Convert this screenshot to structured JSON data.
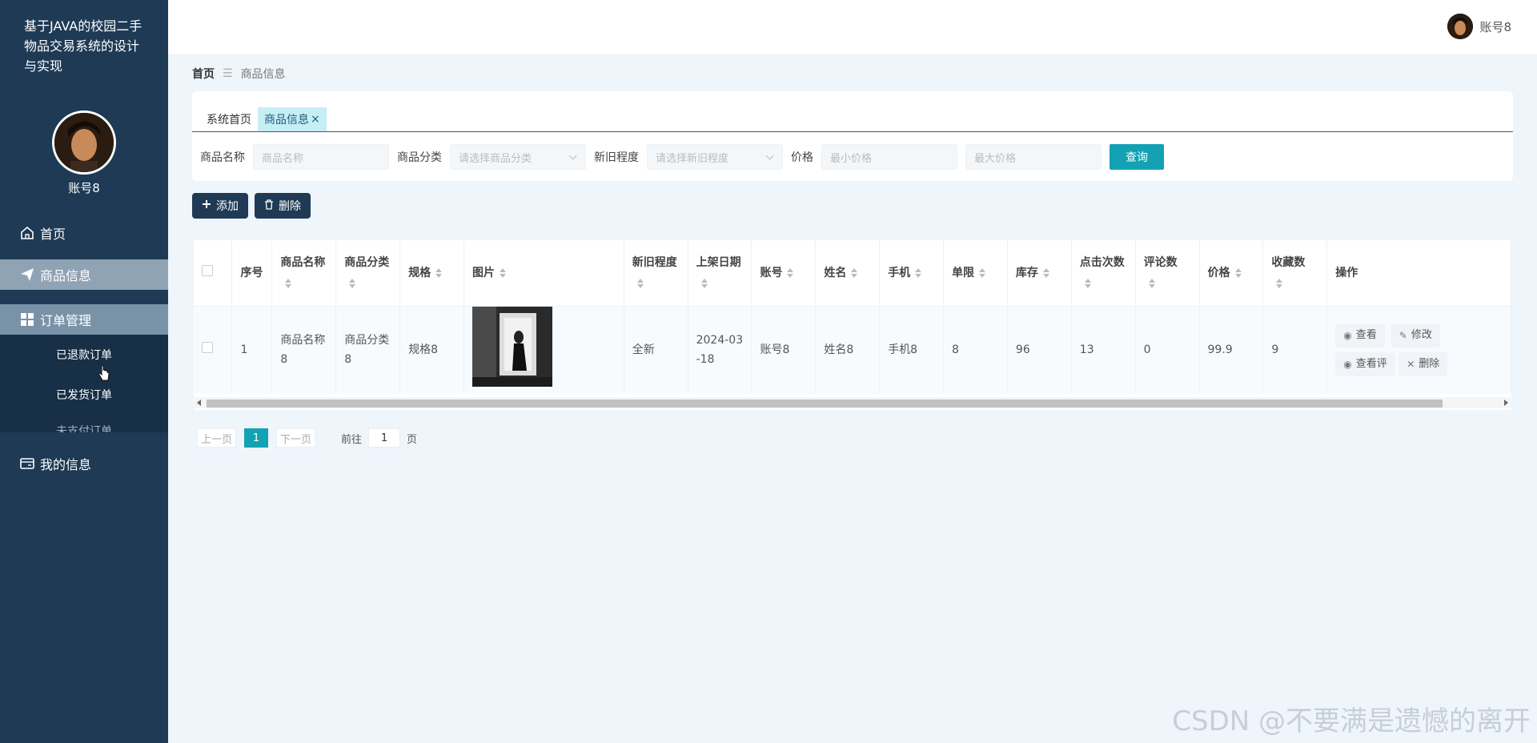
{
  "sidebar": {
    "title": "基于JAVA的校园二手物品交易系统的设计与实现",
    "username": "账号8",
    "menu": {
      "home": "首页",
      "product_info": "商品信息",
      "order_mgmt": "订单管理",
      "sub_refunded": "已退款订单",
      "sub_shipped": "已发货订单",
      "sub_cut": "未支付订单",
      "my_info": "我的信息"
    }
  },
  "header": {
    "username": "账号8"
  },
  "breadcrumb": {
    "home": "首页",
    "separator": "☰",
    "current": "商品信息"
  },
  "tabs": [
    {
      "label": "系统首页"
    },
    {
      "label": "商品信息",
      "close": "×"
    }
  ],
  "search": {
    "name_label": "商品名称",
    "name_placeholder": "商品名称",
    "category_label": "商品分类",
    "category_placeholder": "请选择商品分类",
    "condition_label": "新旧程度",
    "condition_placeholder": "请选择新旧程度",
    "price_label": "价格",
    "price_min_placeholder": "最小价格",
    "price_max_placeholder": "最大价格",
    "query_button": "查询"
  },
  "toolbar": {
    "add_label": "添加",
    "delete_label": "删除"
  },
  "table": {
    "headers": {
      "index": "序号",
      "name": "商品名称",
      "category": "商品分类",
      "spec": "规格",
      "image": "图片",
      "condition": "新旧程度",
      "date": "上架日期",
      "account": "账号",
      "realname": "姓名",
      "phone": "手机",
      "limit": "单限",
      "stock": "库存",
      "clicks": "点击次数",
      "comments": "评论数",
      "price": "价格",
      "favorites": "收藏数",
      "ops": "操作"
    },
    "rows": [
      {
        "index": "1",
        "name": "商品名称8",
        "category": "商品分类8",
        "spec": "规格8",
        "condition": "全新",
        "date": "2024-03-18",
        "account": "账号8",
        "realname": "姓名8",
        "phone": "手机8",
        "limit": "8",
        "stock": "96",
        "clicks": "13",
        "comments": "0",
        "price": "99.9",
        "favorites": "9",
        "op_view": "查看",
        "op_edit": "修改",
        "op_view2": "查看评",
        "op_delete": "删除"
      }
    ]
  },
  "pagination": {
    "prev": "上一页",
    "current": "1",
    "next": "下一页",
    "goto_label": "前往",
    "goto_value": "1",
    "page_suffix": "页"
  },
  "watermark": "CSDN @不要满是遗憾的离开"
}
